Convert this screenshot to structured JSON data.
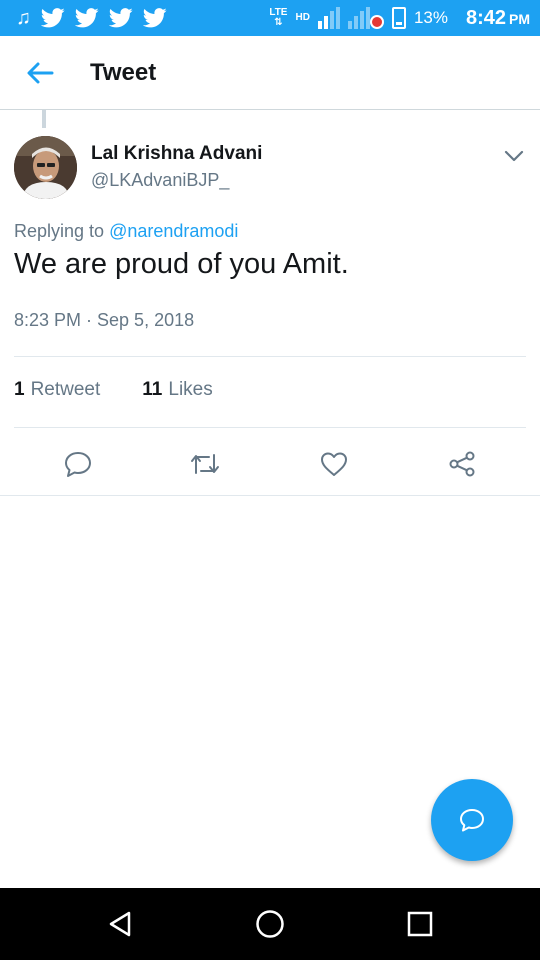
{
  "status_bar": {
    "network_top": "LTE",
    "network_second": "HD",
    "battery_percent": "13%",
    "time": "8:42",
    "ampm": "PM",
    "notification_icons": [
      "music-note-icon",
      "twitter-bird-icon",
      "twitter-bird-icon",
      "twitter-bird-icon",
      "twitter-bird-icon"
    ]
  },
  "header": {
    "title": "Tweet",
    "back_icon": "arrow-left-icon"
  },
  "tweet": {
    "author_name": "Lal Krishna Advani",
    "author_handle": "@LKAdvaniBJP_",
    "replying_prefix": "Replying to ",
    "replying_to": "@narendramodi",
    "text": "We are proud of you Amit.",
    "timestamp": "8:23 PM · Sep 5, 2018",
    "retweet_count": "1",
    "retweet_label": "Retweet",
    "like_count": "11",
    "like_label": "Likes"
  },
  "colors": {
    "accent": "#1da1f2",
    "text_primary": "#14171a",
    "text_secondary": "#657786",
    "divider": "#e1e8ed"
  }
}
